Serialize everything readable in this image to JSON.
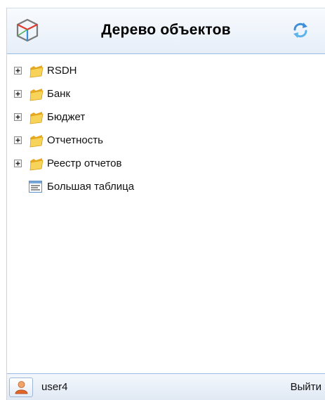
{
  "header": {
    "title": "Дерево объектов",
    "logo_icon": "cube-logo-icon",
    "refresh_icon": "refresh-icon"
  },
  "tree": {
    "items": [
      {
        "label": "RSDH",
        "type": "folder",
        "expandable": true
      },
      {
        "label": "Банк",
        "type": "folder",
        "expandable": true
      },
      {
        "label": "Бюджет",
        "type": "folder",
        "expandable": true
      },
      {
        "label": "Отчетность",
        "type": "folder",
        "expandable": true
      },
      {
        "label": "Реестр отчетов",
        "type": "folder",
        "expandable": true
      },
      {
        "label": "Большая таблица",
        "type": "table",
        "expandable": false
      }
    ]
  },
  "footer": {
    "username": "user4",
    "logout_label": "Выйти"
  },
  "colors": {
    "header_bg": "#e6eef8",
    "border": "#99bbe8",
    "folder": "#f5c542",
    "user_icon": "#e0662a"
  }
}
